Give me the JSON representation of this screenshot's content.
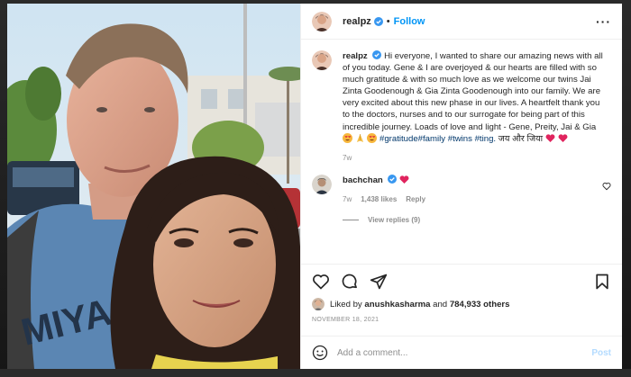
{
  "header": {
    "username": "realpz",
    "separator": "•",
    "follow_label": "Follow",
    "more_label": "···"
  },
  "caption": {
    "username": "realpz",
    "text": "Hi everyone, I wanted to share our amazing news with all of you today. Gene & I are overjoyed & our hearts are filled with so much gratitude & with so much love as we welcome our twins Jai Zinta Goodenough & Gia Zinta Goodenough into our family. We are very excited about this new phase in our lives. A heartfelt thank you to the doctors, nurses and to our surrogate for being part of this incredible journey. Loads of love and light - Gene, Preity, Jai & Gia",
    "hashtags": "#gratitude#family #twins #ting.",
    "hindi": "जय और जिया",
    "time": "7w"
  },
  "comment": {
    "username": "bachchan",
    "time": "7w",
    "likes": "1,438 likes",
    "reply_label": "Reply",
    "view_replies": "View replies (9)"
  },
  "likes": {
    "prefix": "Liked by",
    "user": "anushkasharma",
    "and": "and",
    "count": "784,933 others"
  },
  "date": "NOVEMBER 18, 2021",
  "add_comment": {
    "placeholder": "Add a comment...",
    "post_label": "Post"
  },
  "colors": {
    "accent": "#0095f6",
    "verified": "#3897f0",
    "heart": "#ed4956",
    "hashtag": "#00376b"
  },
  "icons": [
    "verified-icon",
    "more-icon",
    "heart-icon",
    "comment-icon",
    "share-icon",
    "save-icon",
    "smile-icon",
    "emoji-icon"
  ]
}
